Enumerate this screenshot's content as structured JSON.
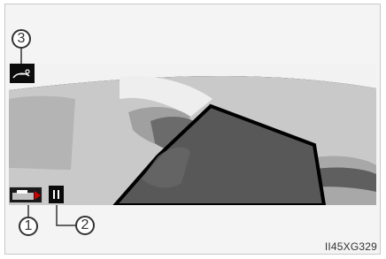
{
  "callouts": {
    "one": "1",
    "two": "2",
    "three": "3"
  },
  "figure_code": "II45XG329",
  "icons": [
    "vehicle-speed-icon",
    "car-view-icon",
    "pause-icon"
  ],
  "colors": {
    "screen_bg": "#000000",
    "road_light": "#cfcfcf",
    "road_mid": "#9a9a9a",
    "vehicle": "#585858"
  }
}
